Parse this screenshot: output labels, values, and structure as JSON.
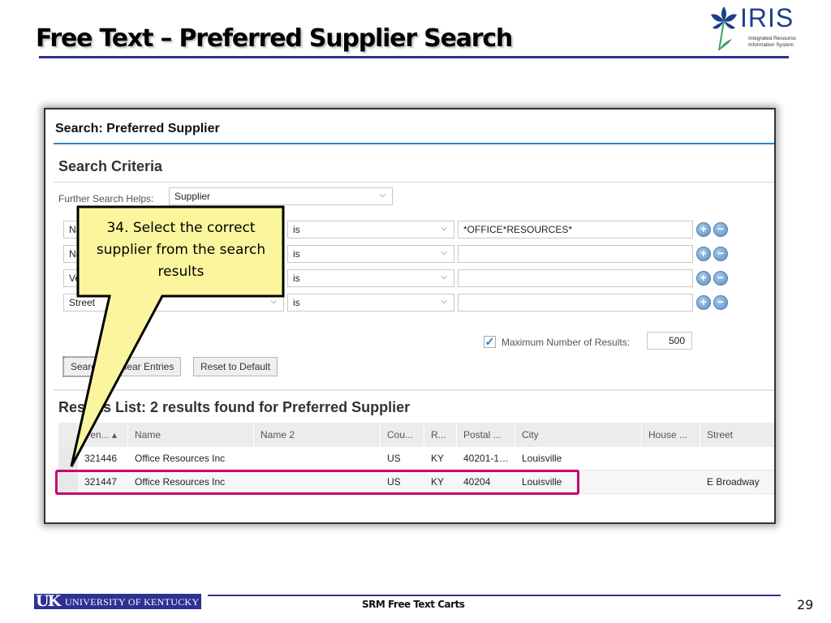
{
  "slide": {
    "title": "Free Text – Preferred Supplier Search",
    "logo": {
      "name": "IRIS",
      "subtitle_line1": "Integrated Resource",
      "subtitle_line2": "Information System"
    },
    "footer": {
      "org_mark": "UK",
      "org_name": "UNIVERSITY OF KENTUCKY",
      "course": "SRM Free Text Carts",
      "page_number": "29"
    },
    "callout": {
      "text_line1": "34. Select the correct",
      "text_line2": "supplier from the search",
      "text_line3": "results"
    },
    "accent_color": "#2e3192",
    "highlight_color": "#c8006e",
    "callout_color": "#fbf59d"
  },
  "panel": {
    "title": "Search: Preferred Supplier",
    "criteria_heading": "Search Criteria",
    "further_search_helps": {
      "label": "Further Search Helps:",
      "value": "Supplier"
    },
    "criteria_rows": [
      {
        "field": "Name",
        "field_visible": "Na",
        "operator": "is",
        "value": "*OFFICE*RESOURCES*"
      },
      {
        "field": "Name",
        "field_visible": "Na",
        "operator": "is",
        "value": ""
      },
      {
        "field": "Vendor",
        "field_visible": "Ve",
        "operator": "is",
        "value": ""
      },
      {
        "field": "Street",
        "field_visible": "Street",
        "operator": "is",
        "value": ""
      }
    ],
    "max_results": {
      "checked": true,
      "label": "Maximum Number of Results:",
      "value": "500"
    },
    "buttons": {
      "search": "Search",
      "clear": "Clear Entries",
      "reset": "Reset to Default"
    },
    "results_heading": "Results List: 2 results found for Preferred Supplier",
    "table": {
      "columns": [
        "Ven... ▴",
        "Name",
        "Name 2",
        "Cou...",
        "R...",
        "Postal ...",
        "City",
        "House ...",
        "Street"
      ],
      "rows": [
        [
          "321446",
          "Office Resources Inc",
          "",
          "US",
          "KY",
          "40201-1…",
          "Louisville",
          "",
          ""
        ],
        [
          "321447",
          "Office Resources Inc",
          "",
          "US",
          "KY",
          "40204",
          "Louisville",
          "",
          "E Broadway"
        ]
      ]
    }
  }
}
